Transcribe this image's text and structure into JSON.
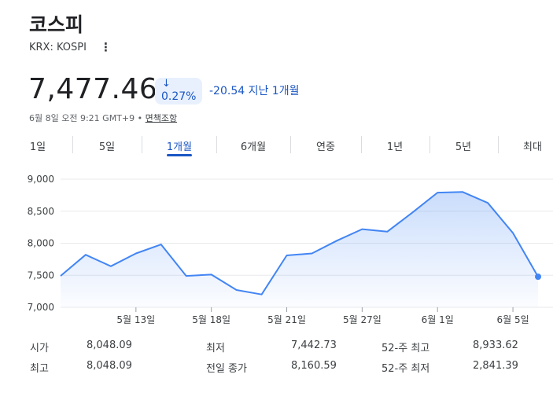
{
  "header": {
    "title": "코스피",
    "ticker": "KRX: KOSPI",
    "more_icon": "more-vert-icon"
  },
  "quote": {
    "price": "7,477.46",
    "change_arrow": "↓",
    "change_pct": "0.27%",
    "change_abs": "-20.54 지난 1개월",
    "timestamp": "6월 8일 오전 9:21 GMT+9 • ",
    "disclaimer": "면책조항",
    "color_down": "#1a56c4"
  },
  "tabs": [
    {
      "label": "1일"
    },
    {
      "label": "5일"
    },
    {
      "label": "1개월",
      "active": true
    },
    {
      "label": "6개월"
    },
    {
      "label": "연중"
    },
    {
      "label": "1년"
    },
    {
      "label": "5년"
    },
    {
      "label": "최대"
    }
  ],
  "chart_data": {
    "type": "area",
    "y_tick_labels": [
      "9,000",
      "8,500",
      "8,000",
      "7,500",
      "7,000"
    ],
    "y_ticks": [
      9000,
      8500,
      8000,
      7500,
      7000
    ],
    "ylim": [
      7000,
      9000
    ],
    "x_tick_labels": [
      "5월 13일",
      "5월 18일",
      "5월 21일",
      "5월 27일",
      "6월 1일",
      "6월 5일"
    ],
    "x_tick_index": [
      3,
      6,
      9,
      12,
      15,
      18
    ],
    "values": [
      7490,
      7820,
      7640,
      7840,
      7980,
      7490,
      7510,
      7270,
      7200,
      7810,
      7840,
      8040,
      8220,
      8180,
      8480,
      8790,
      8800,
      8630,
      8160,
      7477
    ],
    "grid": true,
    "color": "#4285f4"
  },
  "stats": [
    [
      {
        "label": "시가",
        "value": "8,048.09"
      },
      {
        "label": "최저",
        "value": "7,442.73"
      },
      {
        "label": "52-주 최고",
        "value": "8,933.62"
      }
    ],
    [
      {
        "label": "최고",
        "value": "8,048.09"
      },
      {
        "label": "전일 종가",
        "value": "8,160.59"
      },
      {
        "label": "52-주 최저",
        "value": "2,841.39"
      }
    ]
  ]
}
